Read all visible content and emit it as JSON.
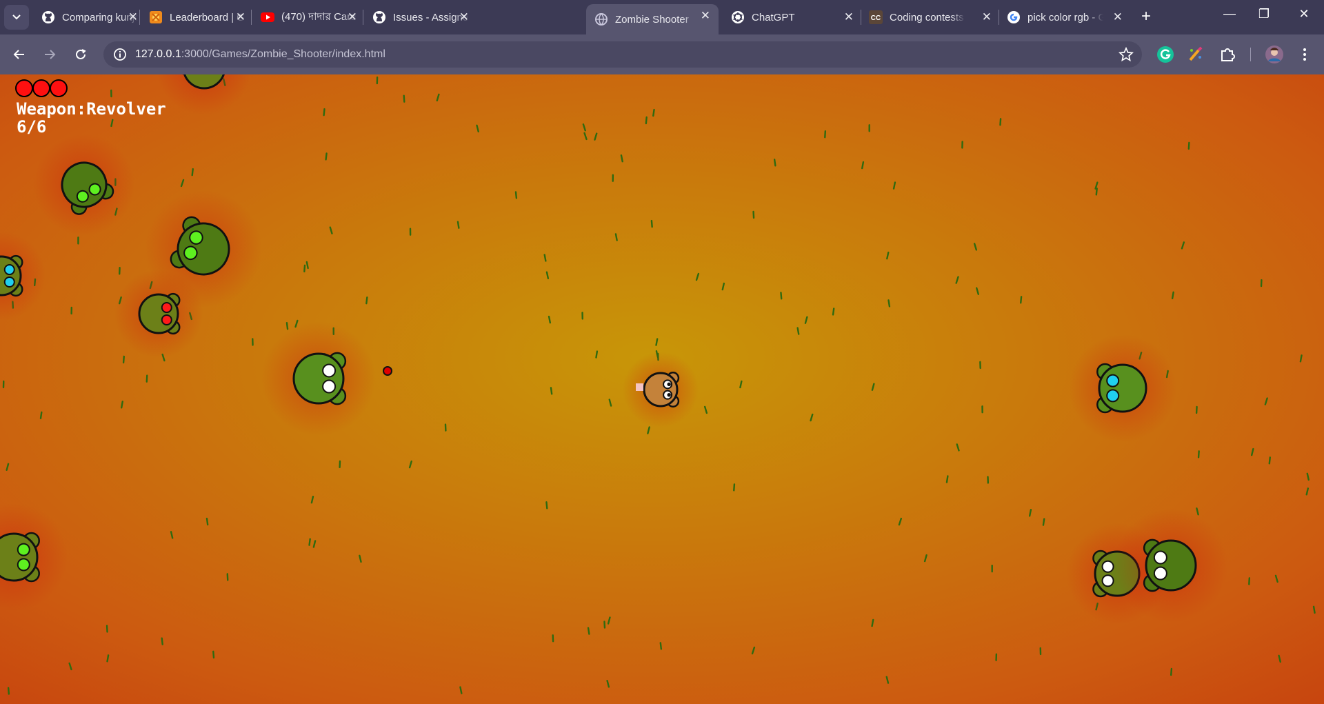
{
  "browser": {
    "tabs": [
      {
        "title": "Comparing kunjo",
        "icon": "github-icon",
        "active": false
      },
      {
        "title": "Leaderboard | Gi",
        "icon": "leaderboard-favicon-icon",
        "active": false
      },
      {
        "title": "(470) দাদার Care",
        "icon": "youtube-icon",
        "active": false
      },
      {
        "title": "Issues - Assigned",
        "icon": "github-icon",
        "active": false
      },
      {
        "title": "Zombie Shooter",
        "icon": "globe-icon",
        "active": true
      },
      {
        "title": "ChatGPT",
        "icon": "chatgpt-icon",
        "active": false
      },
      {
        "title": "Coding contests",
        "icon": "codechef-cc-icon",
        "active": false
      },
      {
        "title": "pick color rgb - G",
        "icon": "google-icon",
        "active": false
      }
    ],
    "address": {
      "host": "127.0.0.1",
      "rest": ":3000/Games/Zombie_Shooter/index.html"
    }
  },
  "game": {
    "lives": 3,
    "weapon_label": "Weapon:",
    "weapon_name": "Revolver",
    "ammo": "6/6",
    "colors": {
      "heart": "#ff1010",
      "player": "#c4823a",
      "zombie_dark": "#4e7a14",
      "zombie_olive": "#6c8018",
      "zombie_light": "#58901e",
      "bullet": "#e00000"
    }
  }
}
